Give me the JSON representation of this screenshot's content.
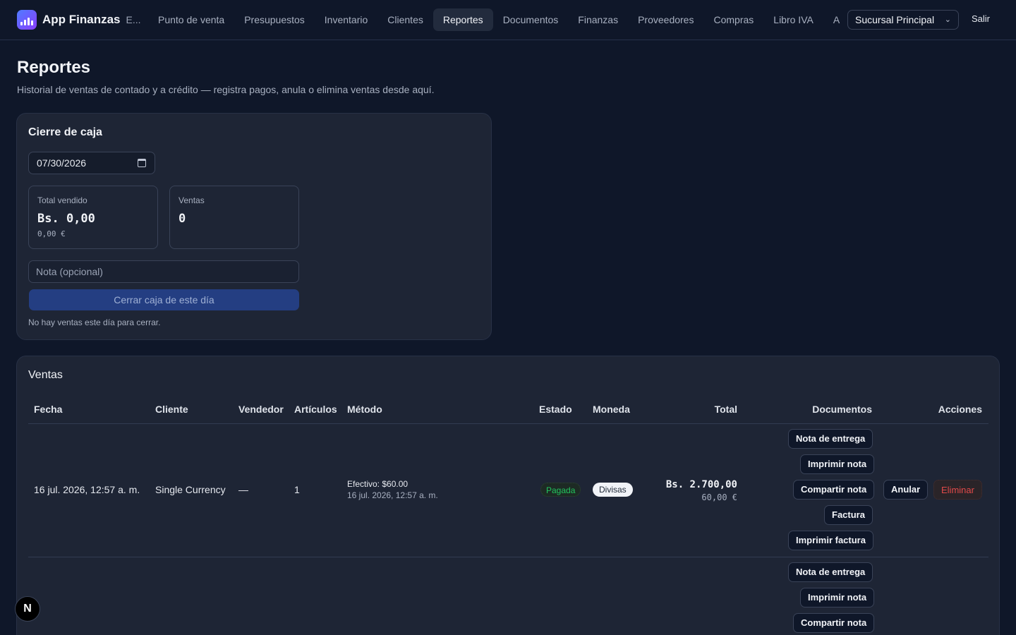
{
  "app": {
    "name": "App Finanzas",
    "sub": "E..."
  },
  "nav": {
    "items": [
      "Punto de venta",
      "Presupuestos",
      "Inventario",
      "Clientes",
      "Reportes",
      "Documentos",
      "Finanzas",
      "Proveedores",
      "Compras",
      "Libro IVA",
      "A"
    ],
    "active": "Reportes"
  },
  "branch": {
    "selected": "Sucursal Principal"
  },
  "logout_label": "Salir",
  "page": {
    "title": "Reportes",
    "subtitle": "Historial de ventas de contado y a crédito — registra pagos, anula o elimina ventas desde aquí."
  },
  "cash_close": {
    "title": "Cierre de caja",
    "date": "07/30/2026",
    "total_label": "Total vendido",
    "total_value": "Bs. 0,00",
    "total_sub": "0,00 €",
    "sales_label": "Ventas",
    "sales_value": "0",
    "note_placeholder": "Nota (opcional)",
    "close_button": "Cerrar caja de este día",
    "hint": "No hay ventas este día para cerrar."
  },
  "sales": {
    "title": "Ventas",
    "columns": [
      "Fecha",
      "Cliente",
      "Vendedor",
      "Artículos",
      "Método",
      "Estado",
      "Moneda",
      "Total",
      "Documentos",
      "Acciones"
    ],
    "rows": [
      {
        "date": "16 jul. 2026, 12:57 a. m.",
        "client": "Single Currency",
        "seller": "—",
        "items": "1",
        "method": "Efectivo: $60.00",
        "method_date": "16 jul. 2026, 12:57 a. m.",
        "status": "Pagada",
        "currency": "Divisas",
        "total": "Bs. 2.700,00",
        "total_sub": "60,00 €",
        "documents": [
          "Nota de entrega",
          "Imprimir nota",
          "Compartir nota",
          "Factura",
          "Imprimir factura"
        ],
        "actions": [
          "Anular",
          "Eliminar"
        ]
      },
      {
        "documents": [
          "Nota de entrega",
          "Imprimir nota",
          "Compartir nota"
        ]
      }
    ]
  },
  "dev_badge": "N",
  "colors": {
    "accent": "#4f7cff",
    "paid": "#22c55e",
    "danger": "#e24a4a",
    "background": "#0f1729",
    "card": "#1e2535"
  }
}
